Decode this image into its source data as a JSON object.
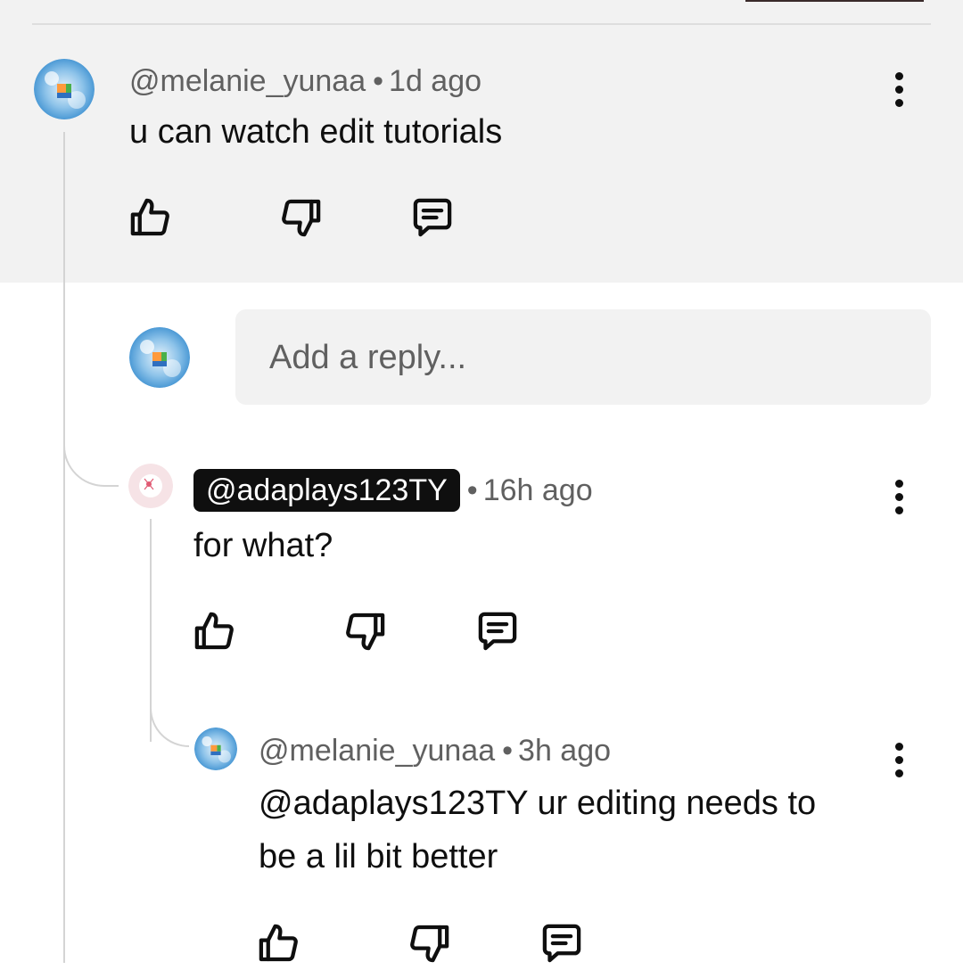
{
  "colors": {
    "highlight_bg": "#f2f2f2",
    "text_primary": "#0f0f0f",
    "text_secondary": "#606060",
    "chip_bg": "#0f0f0f",
    "chip_text": "#ffffff"
  },
  "comment": {
    "author": "@melanie_yunaa",
    "separator": "•",
    "time": "1d ago",
    "text": "u can watch edit tutorials",
    "actions": [
      "thumbs-up-icon",
      "thumbs-down-icon",
      "reply-icon"
    ]
  },
  "reply_input": {
    "placeholder": "Add a reply..."
  },
  "replies": [
    {
      "author": "@adaplays123TY",
      "separator": "•",
      "time": "16h ago",
      "text": "for what?",
      "author_highlighted": true
    },
    {
      "author": "@melanie_yunaa",
      "separator": "•",
      "time": "3h ago",
      "text_line1": "@adaplays123TY ur editing needs to",
      "text_line2": "be a lil bit better"
    }
  ]
}
